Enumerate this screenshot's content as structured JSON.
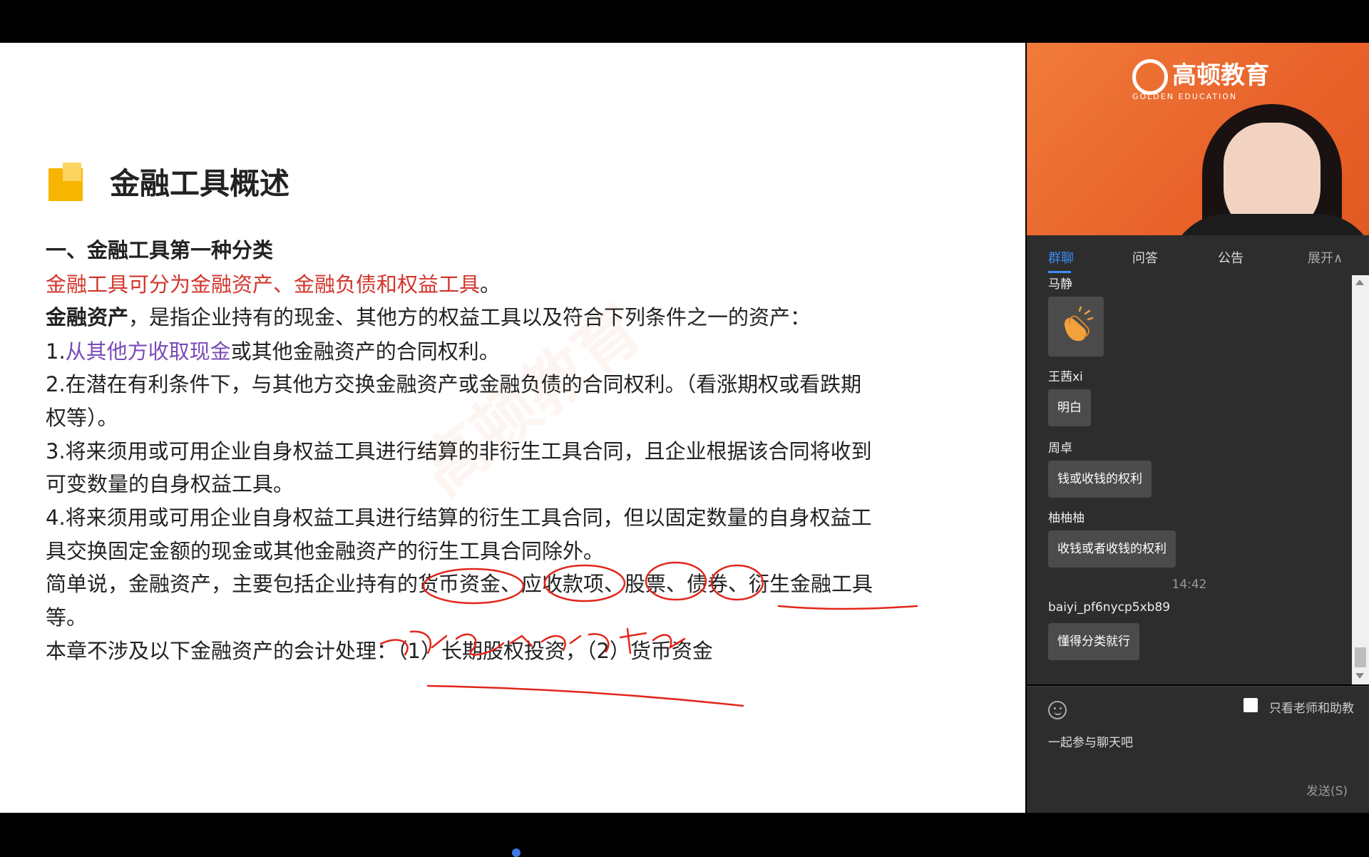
{
  "slide": {
    "title": "金融工具概述",
    "watermark": "高顿教育",
    "lines": [
      {
        "segments": [
          {
            "text": "一、金融工具第一种分类",
            "style": "bold"
          }
        ]
      },
      {
        "segments": [
          {
            "text": "金融工具可分为金融资产、金融负债和权益工具",
            "style": "red"
          },
          {
            "text": "。",
            "style": ""
          }
        ]
      },
      {
        "segments": [
          {
            "text": "金融资产",
            "style": "bold"
          },
          {
            "text": "，是指企业持有的现金、其他方的权益工具以及符合下列条件之一的资产：",
            "style": ""
          }
        ]
      },
      {
        "segments": [
          {
            "text": "1.",
            "style": ""
          },
          {
            "text": "从其他方收取现金",
            "style": "purple"
          },
          {
            "text": "或其他金融资产的合同权利。",
            "style": ""
          }
        ]
      },
      {
        "segments": [
          {
            "text": "2.在潜在有利条件下，与其他方交换金融资产或金融负债的合同权利。（看涨期权或看跌期",
            "style": ""
          }
        ]
      },
      {
        "segments": [
          {
            "text": "权等）。",
            "style": ""
          }
        ]
      },
      {
        "segments": [
          {
            "text": "3.将来须用或可用企业自身权益工具进行结算的非衍生工具合同，且企业根据该合同将收到",
            "style": ""
          }
        ]
      },
      {
        "segments": [
          {
            "text": "可变数量的自身权益工具。",
            "style": ""
          }
        ]
      },
      {
        "segments": [
          {
            "text": "4.将来须用或可用企业自身权益工具进行结算的衍生工具合同，但以固定数量的自身权益工",
            "style": ""
          }
        ]
      },
      {
        "segments": [
          {
            "text": "具交换固定金额的现金或其他金融资产的衍生工具合同除外。",
            "style": ""
          }
        ]
      },
      {
        "segments": [
          {
            "text": "简单说，金融资产，主要包括企业持有的货币资金、应收款项、股票、债券、衍生金融工具",
            "style": ""
          }
        ]
      },
      {
        "segments": [
          {
            "text": "等。",
            "style": ""
          }
        ]
      },
      {
        "segments": [
          {
            "text": "本章不涉及以下金融资产的会计处理：（1）长期股权投资，（2）货币资金",
            "style": ""
          }
        ]
      }
    ]
  },
  "video": {
    "logo_text": "高顿教育",
    "logo_sub": "GOLDEN EDUCATION"
  },
  "tabs": [
    {
      "label": "群聊",
      "active": true
    },
    {
      "label": "问答",
      "active": false
    },
    {
      "label": "公告",
      "active": false
    },
    {
      "label": "展开∧",
      "active": false
    }
  ],
  "chat": {
    "messages": [
      {
        "user": "马静",
        "text": ""
      },
      {
        "user": "王茜xi",
        "text": "明白"
      },
      {
        "user": "周卓",
        "text": "钱或收钱的权利"
      },
      {
        "user": "柚柚柚",
        "text": "收钱或者收钱的权利"
      },
      {
        "time": "14:42"
      },
      {
        "user": "baiyi_pf6nycp5xb89",
        "text": "懂得分类就行"
      }
    ]
  },
  "input": {
    "only_teacher_label": "只看老师和助教",
    "placeholder": "一起参与聊天吧",
    "send_label": "发送(S)"
  }
}
